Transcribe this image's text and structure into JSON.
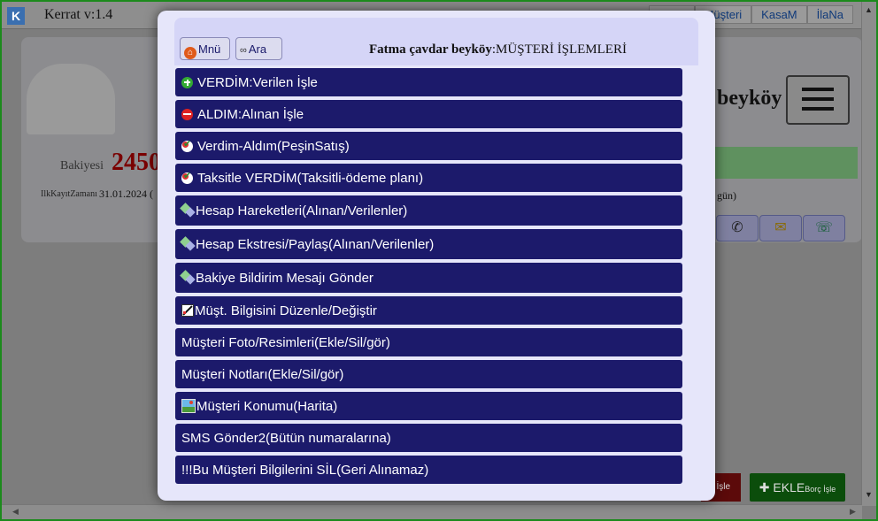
{
  "app": {
    "logo": "K",
    "title": "Kerrat v:1.4",
    "nav": [
      "",
      "Müşteri",
      "KasaM",
      "İlaNa"
    ]
  },
  "background": {
    "balance_label": "Bakiyesi",
    "balance_value": "2450",
    "first_record_label": "IlkKayıtZamanı",
    "first_record_value": "31.01.2024 (",
    "customer_name_partial": "beyköy",
    "days_suffix": "gün)",
    "btn_add_label": "EKLE",
    "btn_add_small": "Borç İşle",
    "btn_red_partial": "t İşle"
  },
  "modal": {
    "menu_button": "Mnü",
    "search_button": "Ara",
    "customer_name": "Fatma çavdar beyköy",
    "title_suffix": ":MÜŞTERİ İŞLEMLERİ",
    "items": [
      {
        "label": "VERDİM:Verilen İşle",
        "icon": "plus-icon"
      },
      {
        "label": "ALDIM:Alınan İşle",
        "icon": "minus-icon"
      },
      {
        "label": "Verdim-Aldım(PeşinSatış)",
        "icon": "check-icon"
      },
      {
        "label": "Taksitle VERDİM(Taksitli-ödeme planı)",
        "icon": "check-icon"
      },
      {
        "label": "Hesap Hareketleri(Alınan/Verilenler)",
        "icon": "transfer-icon"
      },
      {
        "label": "Hesap Ekstresi/Paylaş(Alınan/Verilenler)",
        "icon": "transfer-icon"
      },
      {
        "label": "Bakiye Bildirim Mesajı Gönder",
        "icon": "transfer-icon"
      },
      {
        "label": "Müşt. Bilgisini Düzenle/Değiştir",
        "icon": "edit-icon"
      },
      {
        "label": "Müşteri Foto/Resimleri(Ekle/Sil/gör)",
        "icon": ""
      },
      {
        "label": "Müşteri Notları(Ekle/Sil/gör)",
        "icon": ""
      },
      {
        "label": "Müşteri Konumu(Harita)",
        "icon": "map-icon"
      },
      {
        "label": "SMS Gönder2(Bütün numaralarına)",
        "icon": ""
      },
      {
        "label": "!!!Bu Müşteri Bilgilerini SİL(Geri Alınamaz)",
        "icon": ""
      }
    ]
  }
}
